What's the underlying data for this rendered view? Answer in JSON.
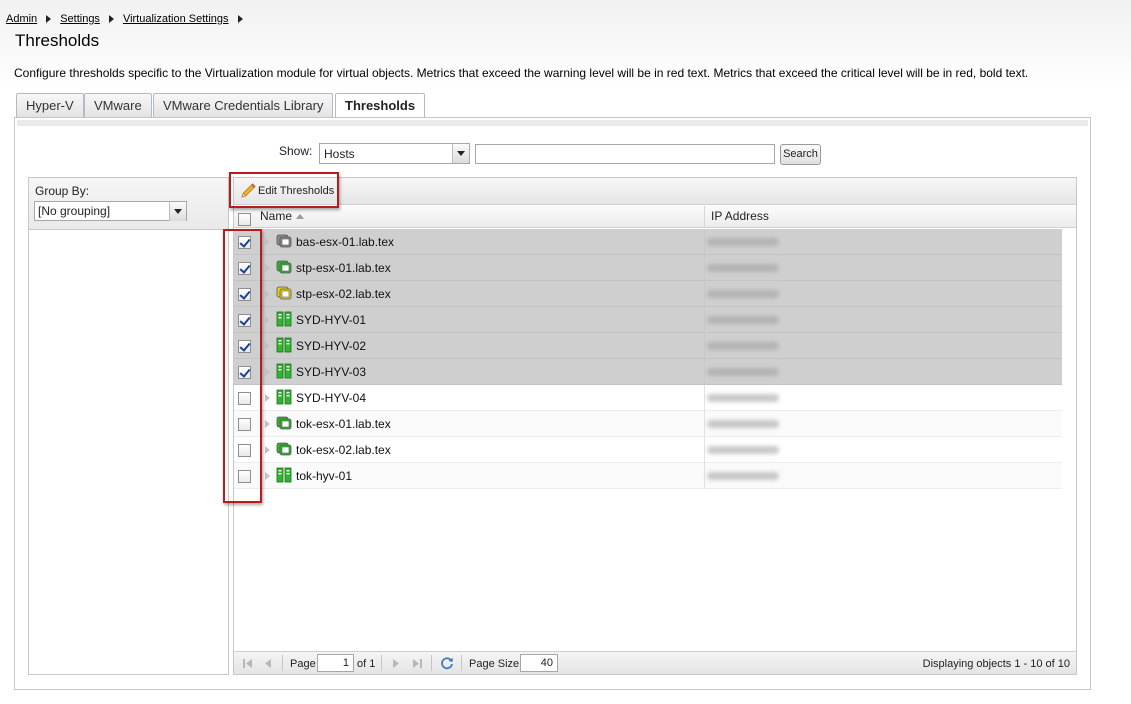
{
  "breadcrumb": [
    "Admin",
    "Settings",
    "Virtualization Settings"
  ],
  "page": {
    "title": "Thresholds",
    "description": "Configure thresholds specific to the Virtualization module for virtual objects. Metrics that exceed the warning level will be in red text. Metrics that exceed the critical level will be in red, bold text."
  },
  "tabs": [
    {
      "label": "Hyper-V",
      "active": false
    },
    {
      "label": "VMware",
      "active": false
    },
    {
      "label": "VMware Credentials Library",
      "active": false
    },
    {
      "label": "Thresholds",
      "active": true
    }
  ],
  "filter": {
    "show_label": "Show:",
    "show_value": "Hosts",
    "search_value": "",
    "search_button": "Search"
  },
  "group_by": {
    "label": "Group By:",
    "value": "[No grouping]"
  },
  "toolbar": {
    "edit_thresholds": "Edit Thresholds"
  },
  "grid": {
    "columns": {
      "name": "Name",
      "ip": "IP Address"
    },
    "rows": [
      {
        "name": "bas-esx-01.lab.tex",
        "checked": true,
        "icon": "vmware-host-icon",
        "status": "gray"
      },
      {
        "name": "stp-esx-01.lab.tex",
        "checked": true,
        "icon": "vmware-host-icon",
        "status": "green"
      },
      {
        "name": "stp-esx-02.lab.tex",
        "checked": true,
        "icon": "vmware-host-icon",
        "status": "yellow"
      },
      {
        "name": "SYD-HYV-01",
        "checked": true,
        "icon": "hyperv-host-icon",
        "status": "green"
      },
      {
        "name": "SYD-HYV-02",
        "checked": true,
        "icon": "hyperv-host-icon",
        "status": "green"
      },
      {
        "name": "SYD-HYV-03",
        "checked": true,
        "icon": "hyperv-host-icon",
        "status": "green"
      },
      {
        "name": "SYD-HYV-04",
        "checked": false,
        "icon": "hyperv-host-icon",
        "status": "green"
      },
      {
        "name": "tok-esx-01.lab.tex",
        "checked": false,
        "icon": "vmware-host-icon",
        "status": "green"
      },
      {
        "name": "tok-esx-02.lab.tex",
        "checked": false,
        "icon": "vmware-host-icon",
        "status": "green"
      },
      {
        "name": "tok-hyv-01",
        "checked": false,
        "icon": "hyperv-host-icon",
        "status": "green"
      }
    ]
  },
  "pager": {
    "page_label": "Page",
    "page_value": "1",
    "of_label": "of 1",
    "page_size_label": "Page Size",
    "page_size_value": "40",
    "display_text": "Displaying objects 1 - 10 of 10"
  },
  "colors": {
    "highlight": "#b51c1c",
    "status_green": "#2fb52f",
    "status_yellow": "#e8d21d",
    "status_gray": "#8a8a8a"
  }
}
